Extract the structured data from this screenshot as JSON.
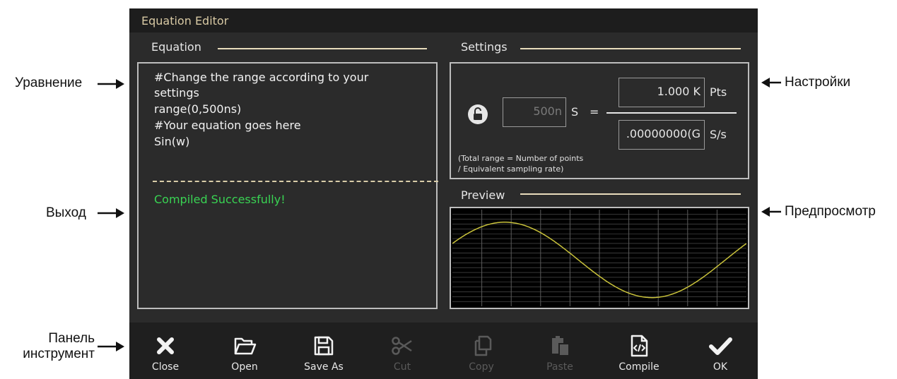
{
  "callouts": {
    "equation": "Уравнение",
    "output": "Выход",
    "toolbar_line1": "Панель",
    "toolbar_line2": "инструмент",
    "settings": "Настройки",
    "preview": "Предпросмотр"
  },
  "dialog": {
    "title": "Equation Editor",
    "equation_section": "Equation",
    "settings_section": "Settings",
    "preview_section": "Preview",
    "code_lines": [
      "#Change the range according to your",
      "settings",
      "range(0,500ns)",
      "#Your equation goes here",
      "Sin(w)"
    ],
    "output_text": "Compiled Successfully!",
    "settings": {
      "time_value": "500n",
      "time_unit": "S",
      "equals": "=",
      "points_value": "1.000 K",
      "points_unit": "Pts",
      "rate_value": ".00000000(G",
      "rate_unit": "S/s",
      "note_line1": "(Total range = Number of points",
      "note_line2": "/ Equivalent sampling rate)",
      "lock_state": "unlocked"
    },
    "preview": {
      "waveform": "sine",
      "trace_color": "#c9c23a",
      "grid_color": "#5b5b5b",
      "background": "#000000"
    }
  },
  "toolbar": {
    "items": [
      {
        "label": "Close",
        "icon": "close-icon",
        "enabled": true
      },
      {
        "label": "Open",
        "icon": "folder-open-icon",
        "enabled": true
      },
      {
        "label": "Save As",
        "icon": "save-icon",
        "enabled": true
      },
      {
        "label": "Cut",
        "icon": "scissors-icon",
        "enabled": false
      },
      {
        "label": "Copy",
        "icon": "copy-icon",
        "enabled": false
      },
      {
        "label": "Paste",
        "icon": "paste-icon",
        "enabled": false
      },
      {
        "label": "Compile",
        "icon": "code-file-icon",
        "enabled": true
      },
      {
        "label": "OK",
        "icon": "checkmark-icon",
        "enabled": true
      }
    ]
  }
}
